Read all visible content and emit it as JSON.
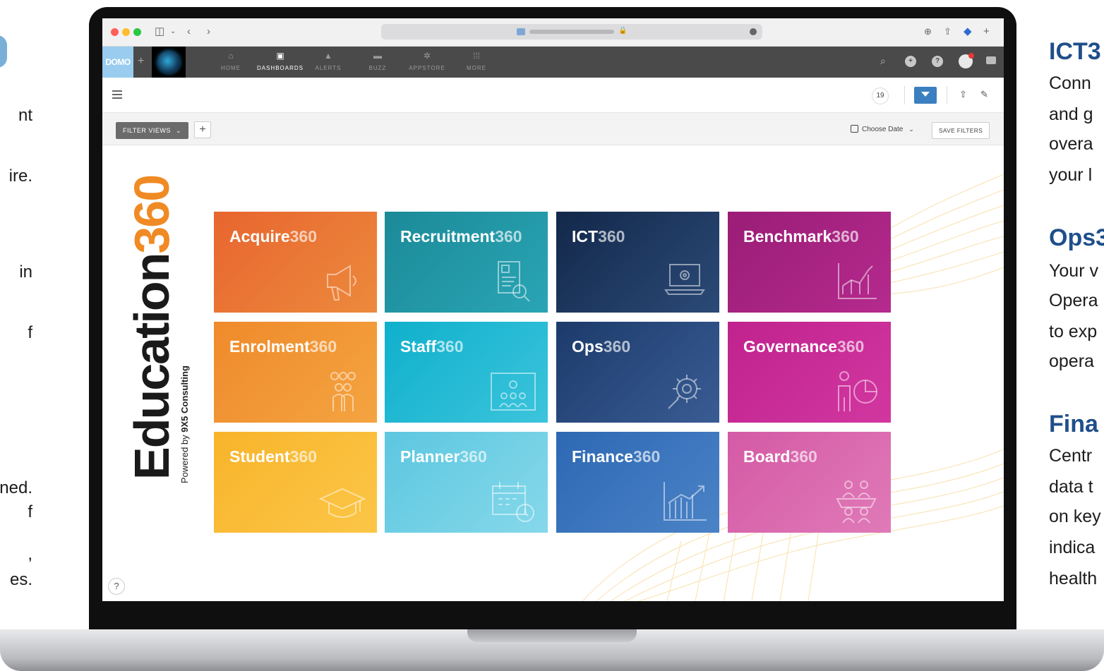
{
  "left_text": [
    "nt",
    "ire.",
    "in",
    "f",
    "ned.",
    "f",
    ",",
    "es."
  ],
  "right_text": {
    "sections": [
      {
        "heading": "ICT3",
        "lines": [
          "Conn",
          "and g",
          "overa",
          "your l"
        ]
      },
      {
        "heading": "Ops3",
        "lines": [
          "Your v",
          "Opera",
          "to exp",
          "opera"
        ]
      },
      {
        "heading": "Fina",
        "lines": [
          "Centr",
          "data t",
          "on key",
          "indica",
          "health"
        ]
      }
    ]
  },
  "nav": {
    "logo": "DOMO",
    "plus": "+",
    "items": [
      {
        "label": "HOME",
        "icon": "home-icon",
        "glyph": "⌂"
      },
      {
        "label": "DASHBOARDS",
        "icon": "dashboard-icon",
        "glyph": "▣"
      },
      {
        "label": "ALERTS",
        "icon": "bell-icon",
        "glyph": "▲"
      },
      {
        "label": "BUZZ",
        "icon": "chat-icon",
        "glyph": "▬"
      },
      {
        "label": "APPSTORE",
        "icon": "appstore-icon",
        "glyph": "✲"
      },
      {
        "label": "MORE",
        "icon": "grid-icon",
        "glyph": "⁞⁞⁞"
      }
    ],
    "active": "DASHBOARDS"
  },
  "toolbar": {
    "count": "19"
  },
  "filterbar": {
    "filter_views": "FILTER VIEWS",
    "add": "+",
    "date_label": "Choose Date",
    "save_filters": "SAVE FILTERS"
  },
  "brand": {
    "title_word": "Education",
    "title_num": "360",
    "subtitle_prefix": "Powered by ",
    "subtitle_company": "9X5 Consulting"
  },
  "tiles": [
    {
      "name": "Acquire",
      "num": "360",
      "icon": "megaphone-icon",
      "color_from": "#e8652f",
      "color_to": "#ec8a3c"
    },
    {
      "name": "Recruitment",
      "num": "360",
      "icon": "document-search-icon",
      "color_from": "#1b8a98",
      "color_to": "#2aa5b5"
    },
    {
      "name": "ICT",
      "num": "360",
      "icon": "laptop-gear-icon",
      "color_from": "#13284a",
      "color_to": "#2b4a77"
    },
    {
      "name": "Benchmark",
      "num": "360",
      "icon": "line-chart-icon",
      "color_from": "#9a1d76",
      "color_to": "#b52a8e"
    },
    {
      "name": "Enrolment",
      "num": "360",
      "icon": "people-group-icon",
      "color_from": "#ef8a2b",
      "color_to": "#f4a441"
    },
    {
      "name": "Staff",
      "num": "360",
      "icon": "presentation-icon",
      "color_from": "#0fb0cc",
      "color_to": "#3cc4dc"
    },
    {
      "name": "Ops",
      "num": "360",
      "icon": "gear-wrench-icon",
      "color_from": "#1c3b6b",
      "color_to": "#3a5c94"
    },
    {
      "name": "Governance",
      "num": "360",
      "icon": "person-pie-icon",
      "color_from": "#c0228e",
      "color_to": "#d237a0"
    },
    {
      "name": "Student",
      "num": "360",
      "icon": "graduation-cap-icon",
      "color_from": "#f8b42b",
      "color_to": "#fcc647"
    },
    {
      "name": "Planner",
      "num": "360",
      "icon": "calendar-clock-icon",
      "color_from": "#5cc7e0",
      "color_to": "#86d8ea"
    },
    {
      "name": "Finance",
      "num": "360",
      "icon": "bar-chart-icon",
      "color_from": "#2d68b4",
      "color_to": "#4b83c6"
    },
    {
      "name": "Board",
      "num": "360",
      "icon": "board-meeting-icon",
      "color_from": "#d45aa5",
      "color_to": "#e07ab8"
    }
  ],
  "help": "?"
}
